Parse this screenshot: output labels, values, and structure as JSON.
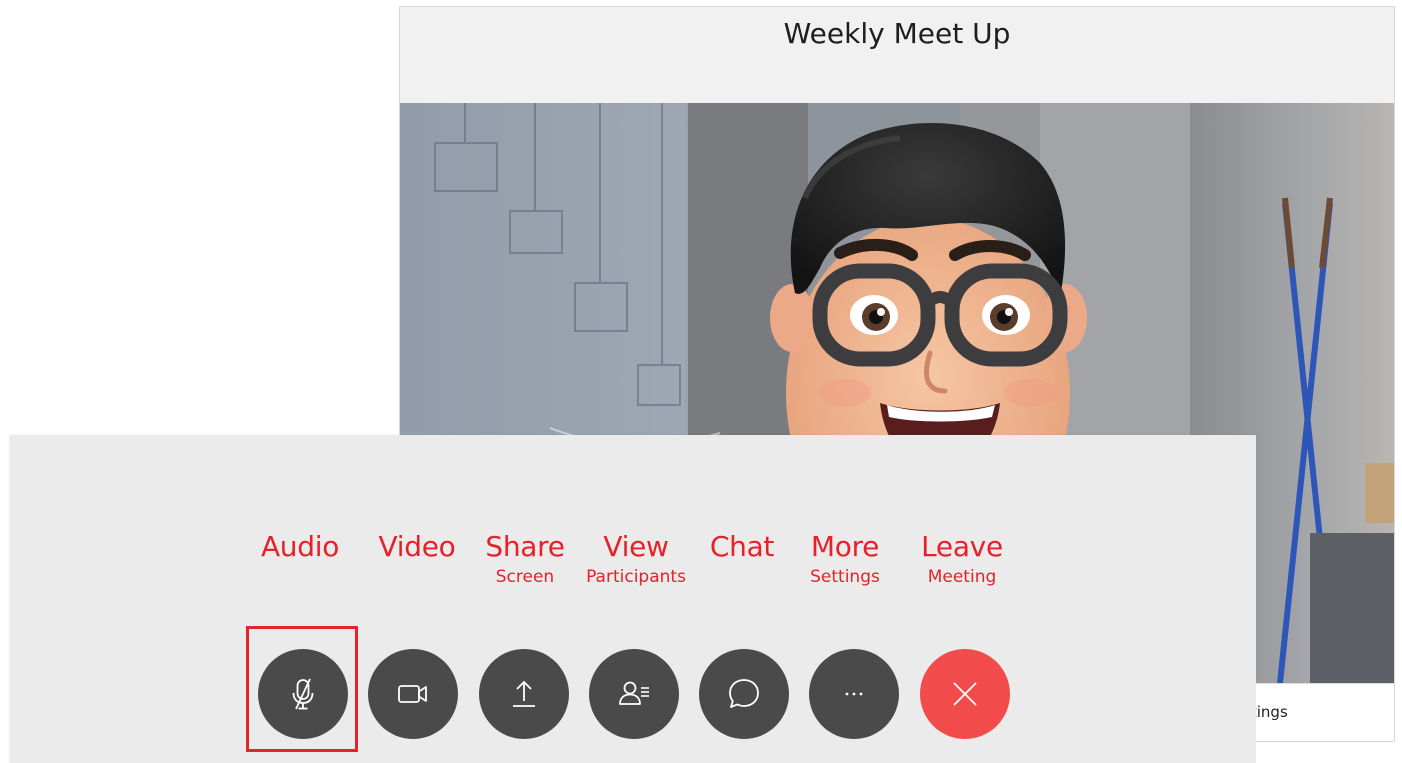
{
  "meeting": {
    "title": "Weekly Meet Up",
    "footer_text": "ttings"
  },
  "toolbar": {
    "buttons": [
      {
        "id": "audio",
        "label": "Audio",
        "sublabel": "",
        "icon": "microphone-muted-icon"
      },
      {
        "id": "video",
        "label": "Video",
        "sublabel": "",
        "icon": "video-camera-icon"
      },
      {
        "id": "share",
        "label": "Share",
        "sublabel": "Screen",
        "icon": "upload-arrow-icon"
      },
      {
        "id": "participants",
        "label": "View",
        "sublabel": "Participants",
        "icon": "participants-icon"
      },
      {
        "id": "chat",
        "label": "Chat",
        "sublabel": "",
        "icon": "chat-bubble-icon"
      },
      {
        "id": "more",
        "label": "More",
        "sublabel": "Settings",
        "icon": "more-dots-icon"
      },
      {
        "id": "leave",
        "label": "Leave",
        "sublabel": "Meeting",
        "icon": "close-x-icon"
      }
    ],
    "highlighted": "audio"
  },
  "colors": {
    "label_red": "#e8202a",
    "button_dark": "#4a4a4a",
    "leave_red": "#f14c4b",
    "highlight_red": "#e3242b",
    "panel_bg": "#ebebeb"
  }
}
